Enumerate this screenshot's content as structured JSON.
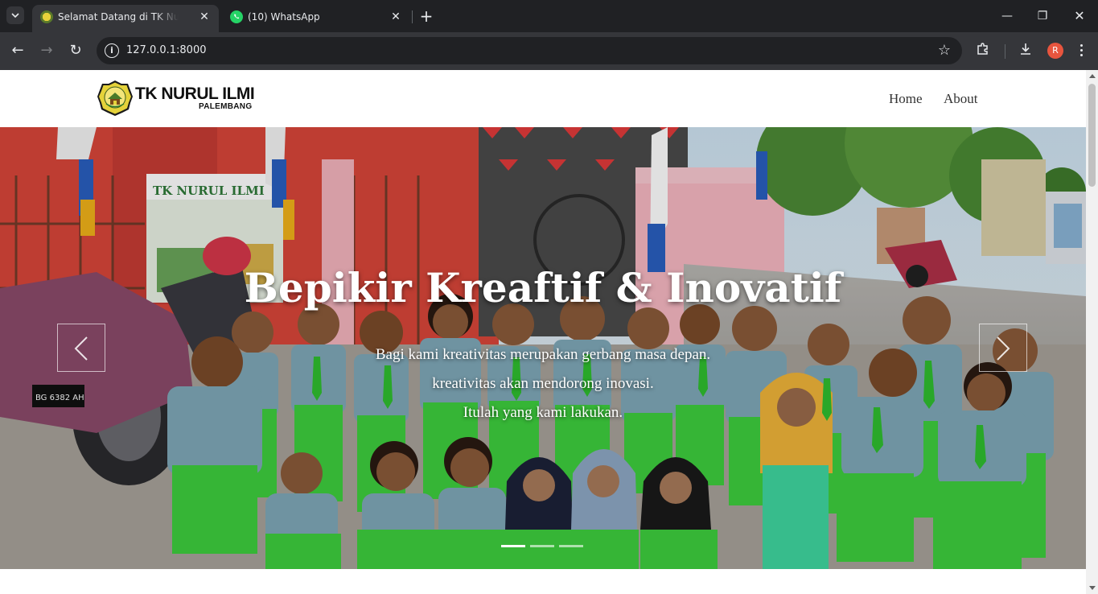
{
  "browser": {
    "tabs": [
      {
        "title": "Selamat Datang di TK Nurul Ilmi",
        "active": true
      },
      {
        "title": "(10) WhatsApp",
        "active": false
      }
    ],
    "url": "127.0.0.1:8000",
    "profile_initial": "R",
    "icons": {
      "tab_search": "chevron-down-icon",
      "back": "arrow-left-icon",
      "forward": "arrow-right-icon",
      "reload": "reload-icon",
      "site_info": "info-icon",
      "bookmark": "star-icon",
      "extensions": "puzzle-icon",
      "downloads": "download-icon",
      "menu": "kebab-icon"
    }
  },
  "site": {
    "brand": {
      "name": "TK NURUL ILMI",
      "city": "PALEMBANG"
    },
    "nav": [
      {
        "label": "Home"
      },
      {
        "label": "About"
      }
    ]
  },
  "hero": {
    "title": "Bepikir Kreaftif & Inovatif",
    "lines": [
      "Bagi kami kreativitas merupakan gerbang masa depan.",
      "kreativitas akan mendorong inovasi.",
      "Itulah yang kami lakukan."
    ],
    "slides_total": 3,
    "slide_active": 1
  },
  "colors": {
    "chrome_dark": "#202124",
    "chrome_mid": "#35363a",
    "uniform_green": "#3ecf3e",
    "profile": "#e8553e"
  }
}
